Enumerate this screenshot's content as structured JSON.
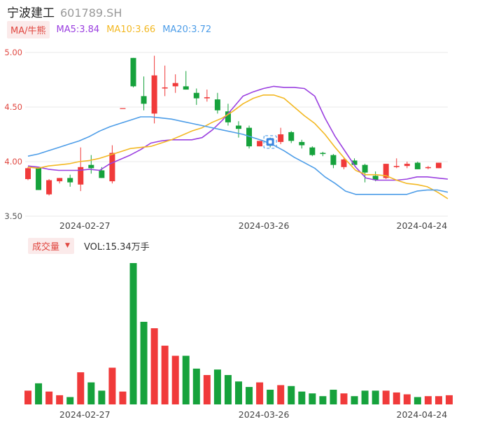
{
  "header": {
    "stock_name": "宁波建工",
    "stock_code": "601789.SH"
  },
  "ma_legend": {
    "badge": "MA/牛熊",
    "items": [
      {
        "label": "MA5:3.84",
        "color": "#9b40e0"
      },
      {
        "label": "MA10:3.66",
        "color": "#f3b822"
      },
      {
        "label": "MA20:3.72",
        "color": "#4d9de8"
      }
    ]
  },
  "volume_legend": {
    "badge": "成交量",
    "caret": "▼",
    "text": "VOL:15.34万手"
  },
  "colors": {
    "up": "#f03a3a",
    "down": "#16a23c",
    "ma5": "#9b40e0",
    "ma10": "#f3b822",
    "ma20": "#4d9de8",
    "grid": "#e8e8e8"
  },
  "chart_data": [
    {
      "type": "candlestick",
      "title": "宁波建工 601789.SH",
      "ylim": [
        3.5,
        5.0
      ],
      "y_ticks": [
        "5.00",
        "4.50",
        "4.00",
        "3.50"
      ],
      "x_tick_labels": [
        {
          "index": 5,
          "label": "2024-02-27"
        },
        {
          "index": 22,
          "label": "2024-03-26"
        },
        {
          "index": 37,
          "label": "2024-04-24"
        }
      ],
      "candles": [
        {
          "o": 3.84,
          "h": 3.95,
          "l": 3.83,
          "c": 3.94
        },
        {
          "o": 3.94,
          "h": 3.95,
          "l": 3.74,
          "c": 3.74
        },
        {
          "o": 3.7,
          "h": 3.84,
          "l": 3.69,
          "c": 3.83
        },
        {
          "o": 3.82,
          "h": 3.85,
          "l": 3.8,
          "c": 3.85
        },
        {
          "o": 3.85,
          "h": 3.88,
          "l": 3.77,
          "c": 3.81
        },
        {
          "o": 3.79,
          "h": 4.13,
          "l": 3.73,
          "c": 3.95
        },
        {
          "o": 3.97,
          "h": 4.06,
          "l": 3.89,
          "c": 3.94
        },
        {
          "o": 3.92,
          "h": 3.95,
          "l": 3.85,
          "c": 3.85
        },
        {
          "o": 3.82,
          "h": 4.15,
          "l": 3.8,
          "c": 4.08
        },
        {
          "o": 4.49,
          "h": 4.49,
          "l": 4.49,
          "c": 4.49
        },
        {
          "o": 4.95,
          "h": 4.95,
          "l": 4.68,
          "c": 4.69
        },
        {
          "o": 4.6,
          "h": 4.78,
          "l": 4.47,
          "c": 4.53
        },
        {
          "o": 4.44,
          "h": 4.97,
          "l": 4.35,
          "c": 4.79
        },
        {
          "o": 4.67,
          "h": 4.88,
          "l": 4.6,
          "c": 4.68
        },
        {
          "o": 4.69,
          "h": 4.8,
          "l": 4.63,
          "c": 4.72
        },
        {
          "o": 4.69,
          "h": 4.83,
          "l": 4.66,
          "c": 4.66
        },
        {
          "o": 4.63,
          "h": 4.67,
          "l": 4.52,
          "c": 4.58
        },
        {
          "o": 4.58,
          "h": 4.66,
          "l": 4.55,
          "c": 4.59
        },
        {
          "o": 4.57,
          "h": 4.63,
          "l": 4.44,
          "c": 4.47
        },
        {
          "o": 4.46,
          "h": 4.53,
          "l": 4.33,
          "c": 4.36
        },
        {
          "o": 4.33,
          "h": 4.37,
          "l": 4.22,
          "c": 4.3
        },
        {
          "o": 4.31,
          "h": 4.33,
          "l": 4.12,
          "c": 4.14
        },
        {
          "o": 4.14,
          "h": 4.17,
          "l": 4.14,
          "c": 4.19
        },
        {
          "o": 4.2,
          "h": 4.22,
          "l": 4.13,
          "c": 4.17
        },
        {
          "o": 4.18,
          "h": 4.31,
          "l": 4.16,
          "c": 4.25
        },
        {
          "o": 4.27,
          "h": 4.28,
          "l": 4.17,
          "c": 4.19
        },
        {
          "o": 4.18,
          "h": 4.2,
          "l": 4.12,
          "c": 4.15
        },
        {
          "o": 4.13,
          "h": 4.14,
          "l": 4.05,
          "c": 4.06
        },
        {
          "o": 4.08,
          "h": 4.09,
          "l": 4.05,
          "c": 4.07
        },
        {
          "o": 4.06,
          "h": 4.07,
          "l": 3.94,
          "c": 3.97
        },
        {
          "o": 3.95,
          "h": 4.03,
          "l": 3.93,
          "c": 4.02
        },
        {
          "o": 4.01,
          "h": 4.03,
          "l": 3.96,
          "c": 3.97
        },
        {
          "o": 3.97,
          "h": 3.98,
          "l": 3.81,
          "c": 3.9
        },
        {
          "o": 3.87,
          "h": 3.91,
          "l": 3.82,
          "c": 3.83
        },
        {
          "o": 3.85,
          "h": 3.98,
          "l": 3.84,
          "c": 3.98
        },
        {
          "o": 3.95,
          "h": 4.03,
          "l": 3.94,
          "c": 3.96
        },
        {
          "o": 3.96,
          "h": 4.0,
          "l": 3.94,
          "c": 3.98
        },
        {
          "o": 3.99,
          "h": 4.0,
          "l": 3.93,
          "c": 3.93
        },
        {
          "o": 3.94,
          "h": 3.96,
          "l": 3.93,
          "c": 3.95
        },
        {
          "o": 3.94,
          "h": 3.99,
          "l": 3.94,
          "c": 3.99
        }
      ],
      "series": [
        {
          "name": "MA5",
          "values": [
            3.96,
            3.95,
            3.93,
            3.92,
            3.92,
            3.92,
            3.93,
            3.92,
            3.98,
            4.02,
            4.06,
            4.11,
            4.17,
            4.19,
            4.2,
            4.2,
            4.2,
            4.22,
            4.29,
            4.38,
            4.49,
            4.6,
            4.64,
            4.67,
            4.69,
            4.68,
            4.68,
            4.67,
            4.6,
            4.4,
            4.23,
            4.09,
            3.95,
            3.85,
            3.83,
            3.83,
            3.83,
            3.84,
            3.86,
            3.86,
            3.85,
            3.84
          ]
        },
        {
          "name": "MA10",
          "values": [
            3.95,
            3.94,
            3.96,
            3.97,
            3.98,
            4.0,
            4.01,
            4.03,
            4.06,
            4.09,
            4.12,
            4.13,
            4.14,
            4.17,
            4.2,
            4.24,
            4.28,
            4.31,
            4.36,
            4.4,
            4.46,
            4.53,
            4.58,
            4.61,
            4.61,
            4.58,
            4.5,
            4.42,
            4.35,
            4.25,
            4.13,
            4.02,
            3.92,
            3.88,
            3.88,
            3.87,
            3.83,
            3.8,
            3.79,
            3.77,
            3.72,
            3.66
          ]
        },
        {
          "name": "MA20",
          "values": [
            4.05,
            4.07,
            4.1,
            4.13,
            4.16,
            4.19,
            4.23,
            4.28,
            4.32,
            4.35,
            4.38,
            4.41,
            4.41,
            4.4,
            4.39,
            4.37,
            4.35,
            4.33,
            4.31,
            4.29,
            4.27,
            4.25,
            4.22,
            4.19,
            4.15,
            4.1,
            4.04,
            3.99,
            3.94,
            3.86,
            3.8,
            3.73,
            3.7,
            3.7,
            3.7,
            3.7,
            3.7,
            3.7,
            3.73,
            3.74,
            3.74,
            3.72
          ]
        }
      ]
    },
    {
      "type": "bar",
      "title": "成交量",
      "unit": "万手",
      "x_tick_labels": [
        {
          "index": 5,
          "label": "2024-02-27"
        },
        {
          "index": 22,
          "label": "2024-03-26"
        },
        {
          "index": 37,
          "label": "2024-04-24"
        }
      ],
      "values": [
        15,
        23,
        14,
        10,
        8,
        35,
        24,
        15,
        40,
        14,
        154,
        90,
        83,
        64,
        53,
        53,
        39,
        32,
        38,
        32,
        25,
        19,
        24,
        16,
        21,
        20,
        14,
        12,
        9,
        16,
        12,
        9,
        15,
        15,
        15,
        13,
        11,
        8,
        9,
        9,
        10
      ]
    }
  ]
}
